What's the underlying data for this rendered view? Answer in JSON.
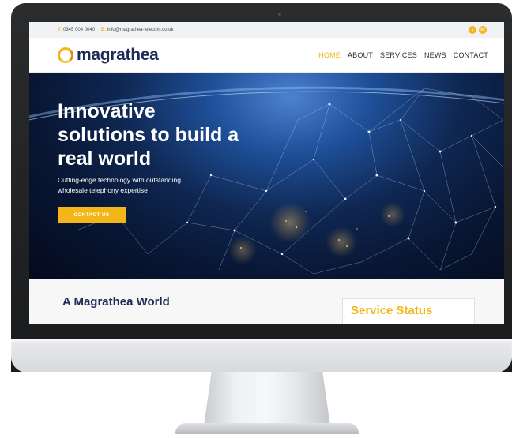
{
  "topbar": {
    "phone_label": "T:",
    "phone": "0345 004 0040",
    "email_label": "E:",
    "email": "info@magrathea-telecom.co.uk",
    "social_icons": [
      "twitter-icon",
      "linkedin-icon"
    ]
  },
  "header": {
    "logo_text": "magrathea",
    "nav": [
      {
        "label": "HOME",
        "active": true
      },
      {
        "label": "ABOUT",
        "active": false
      },
      {
        "label": "SERVICES",
        "active": false
      },
      {
        "label": "NEWS",
        "active": false
      },
      {
        "label": "CONTACT",
        "active": false
      }
    ]
  },
  "hero": {
    "title_lines": [
      "Innovative",
      "solutions to build a",
      "real world"
    ],
    "subtitle_lines": [
      "Cutting-edge technology with outstanding",
      "wholesale telephony expertise"
    ],
    "cta_label": "CONTACT US"
  },
  "section": {
    "world_title": "A Magrathea World",
    "status_title": "Service Status"
  },
  "colors": {
    "accent": "#f2b619",
    "brand_navy": "#1f2b56",
    "hero_deep": "#081633"
  }
}
